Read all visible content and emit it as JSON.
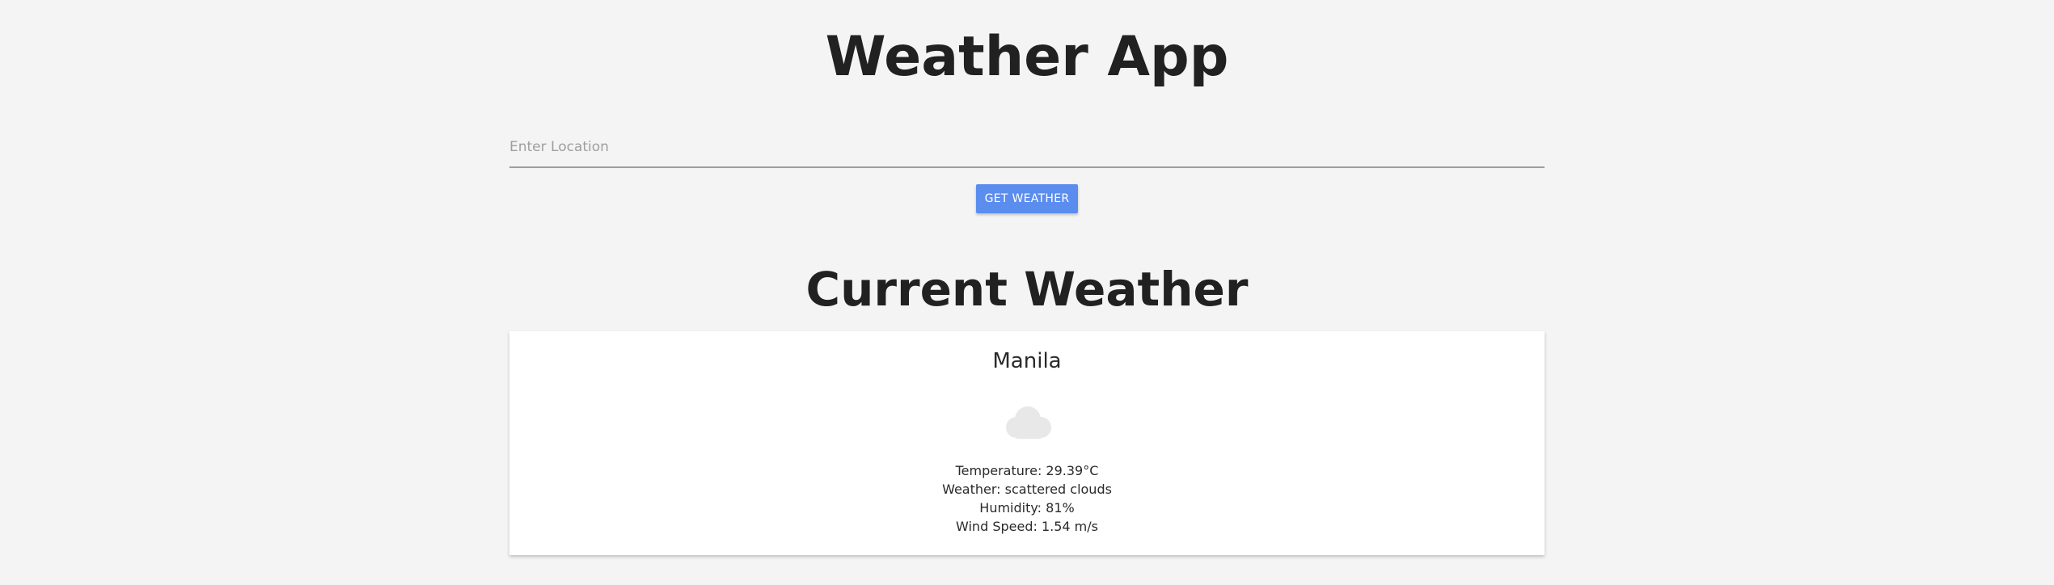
{
  "header": {
    "title": "Weather App"
  },
  "search": {
    "placeholder": "Enter Location",
    "value": "",
    "button_label": "GET WEATHER"
  },
  "current": {
    "section_title": "Current Weather",
    "city": "Manila",
    "icon": "cloud-icon",
    "temperature": "Temperature: 29.39°C",
    "weather": "Weather: scattered clouds",
    "humidity": "Humidity: 81%",
    "wind": "Wind Speed: 1.54 m/s"
  },
  "colors": {
    "background": "#f4f4f4",
    "button": "#5b8def",
    "card": "#ffffff",
    "icon": "#e8e8e8"
  }
}
